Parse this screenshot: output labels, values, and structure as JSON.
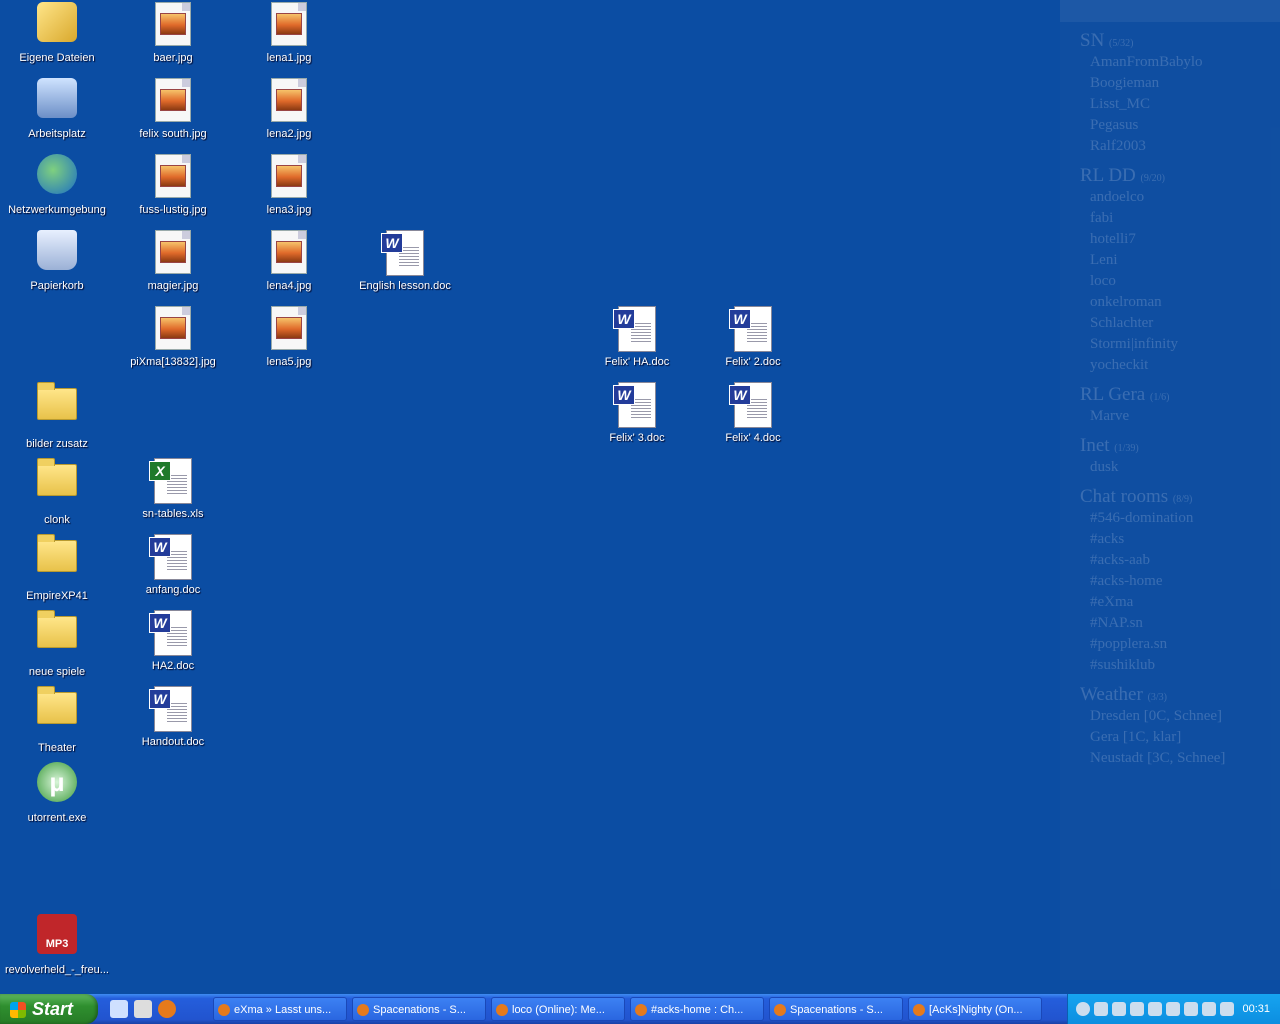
{
  "desktop": {
    "icons": {
      "eigene_dateien": "Eigene Dateien",
      "arbeitsplatz": "Arbeitsplatz",
      "netzwerk": "Netzwerkumgebung",
      "papierkorb": "Papierkorb",
      "baer": "baer.jpg",
      "felix_south": "felix south.jpg",
      "fuss_lustig": "fuss-lustig.jpg",
      "magier": "magier.jpg",
      "pixma": "piXma[13832].jpg",
      "lena1": "lena1.jpg",
      "lena2": "lena2.jpg",
      "lena3": "lena3.jpg",
      "lena4": "lena4.jpg",
      "lena5": "lena5.jpg",
      "english_lesson": "English lesson.doc",
      "felix_ha": "Felix' HA.doc",
      "felix_2": "Felix' 2.doc",
      "felix_3": "Felix' 3.doc",
      "felix_4": "Felix' 4.doc",
      "bilder_zusatz": "bilder zusatz",
      "clonk": "clonk",
      "empire": "EmpireXP41",
      "neue_spiele": "neue spiele",
      "theater": "Theater",
      "utorrent": "utorrent.exe",
      "sn_tables": "sn-tables.xls",
      "anfang": "anfang.doc",
      "ha2": "HA2.doc",
      "handout": "Handout.doc",
      "revolverheld": "revolverheld_-_freu..."
    }
  },
  "widget": {
    "sections": [
      {
        "title": "SN",
        "count": "(5/32)",
        "items": [
          "AmanFromBabylo",
          "Boogieman",
          "Lisst_MC",
          "Pegasus",
          "Ralf2003"
        ]
      },
      {
        "title": "RL DD",
        "count": "(9/20)",
        "items": [
          "andoelco",
          "fabi",
          "hotelli7",
          "Leni",
          "loco",
          "onkelroman",
          "Schlachter",
          "Stormi|infinity",
          "yocheckit"
        ]
      },
      {
        "title": "RL Gera",
        "count": "(1/6)",
        "items": [
          "Marve"
        ]
      },
      {
        "title": "Inet",
        "count": "(1/39)",
        "items": [
          "dusk"
        ]
      },
      {
        "title": "Chat rooms",
        "count": "(8/9)",
        "items": [
          "#546-domination",
          "#acks",
          "#acks-aab",
          "#acks-home",
          "#eXma",
          "#NAP.sn",
          "#popplera.sn",
          "#sushiklub"
        ]
      },
      {
        "title": "Weather",
        "count": "(3/3)",
        "items": [
          "Dresden [0C, Schnee]",
          "Gera [1C, klar]",
          "Neustadt [3C, Schnee]"
        ]
      }
    ]
  },
  "taskbar": {
    "start_label": "Start",
    "tasks": [
      "eXma » Lasst uns...",
      "Spacenations - S...",
      "loco (Online): Me...",
      "#acks-home : Ch...",
      "Spacenations - S...",
      "[AcKs]Nighty (On..."
    ],
    "clock": "00:31"
  }
}
